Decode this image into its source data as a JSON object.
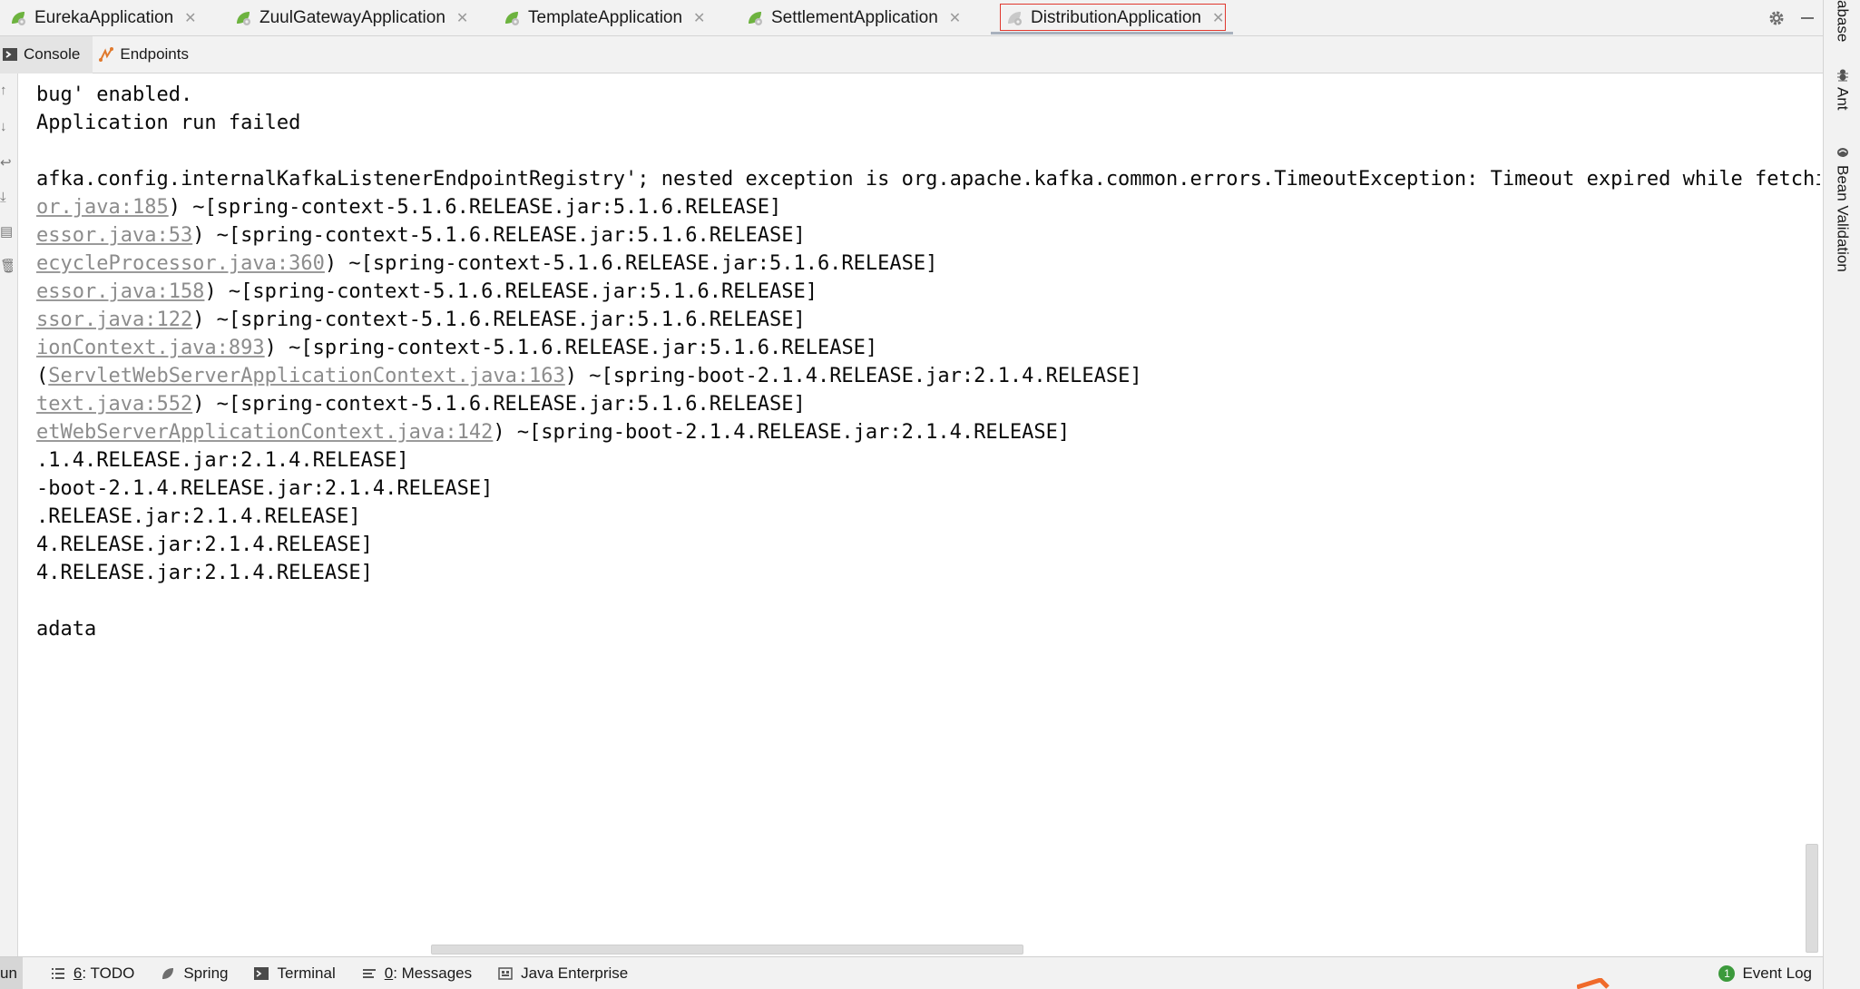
{
  "run_tabs": [
    {
      "label": "EurekaApplication",
      "active": false
    },
    {
      "label": "ZuulGatewayApplication",
      "active": false
    },
    {
      "label": "TemplateApplication",
      "active": false
    },
    {
      "label": "SettlementApplication",
      "active": false
    },
    {
      "label": "DistributionApplication",
      "active": true
    }
  ],
  "sub_tabs": {
    "console": "Console",
    "endpoints": "Endpoints"
  },
  "console_lines": [
    {
      "link": "",
      "text": "bug' enabled."
    },
    {
      "link": "",
      "text": "Application run failed"
    },
    {
      "link": "",
      "text": ""
    },
    {
      "link": "",
      "text": "afka.config.internalKafkaListenerEndpointRegistry'; nested exception is org.apache.kafka.common.errors.TimeoutException: Timeout expired while fetching"
    },
    {
      "prefix": "",
      "link": "or.java:185",
      "text": ") ~[spring-context-5.1.6.RELEASE.jar:5.1.6.RELEASE]"
    },
    {
      "prefix": "",
      "link": "essor.java:53",
      "text": ") ~[spring-context-5.1.6.RELEASE.jar:5.1.6.RELEASE]"
    },
    {
      "prefix": "",
      "link": "ecycleProcessor.java:360",
      "text": ") ~[spring-context-5.1.6.RELEASE.jar:5.1.6.RELEASE]"
    },
    {
      "prefix": "",
      "link": "essor.java:158",
      "text": ") ~[spring-context-5.1.6.RELEASE.jar:5.1.6.RELEASE]"
    },
    {
      "prefix": "",
      "link": "ssor.java:122",
      "text": ") ~[spring-context-5.1.6.RELEASE.jar:5.1.6.RELEASE]"
    },
    {
      "prefix": "",
      "link": "ionContext.java:893",
      "text": ") ~[spring-context-5.1.6.RELEASE.jar:5.1.6.RELEASE]"
    },
    {
      "prefix": "(",
      "link": "ServletWebServerApplicationContext.java:163",
      "text": ") ~[spring-boot-2.1.4.RELEASE.jar:2.1.4.RELEASE]"
    },
    {
      "prefix": "",
      "link": "text.java:552",
      "text": ") ~[spring-context-5.1.6.RELEASE.jar:5.1.6.RELEASE]"
    },
    {
      "prefix": "",
      "link": "etWebServerApplicationContext.java:142",
      "text": ") ~[spring-boot-2.1.4.RELEASE.jar:2.1.4.RELEASE]"
    },
    {
      "prefix": "",
      "link": "",
      "text": ".1.4.RELEASE.jar:2.1.4.RELEASE]"
    },
    {
      "prefix": "",
      "link": "",
      "text": "-boot-2.1.4.RELEASE.jar:2.1.4.RELEASE]"
    },
    {
      "prefix": "",
      "link": "",
      "text": ".RELEASE.jar:2.1.4.RELEASE]"
    },
    {
      "prefix": "",
      "link": "",
      "text": "4.RELEASE.jar:2.1.4.RELEASE]"
    },
    {
      "prefix": "",
      "link": "",
      "text": "4.RELEASE.jar:2.1.4.RELEASE]"
    },
    {
      "prefix": "",
      "link": "",
      "text": ""
    },
    {
      "prefix": "",
      "link": "",
      "text": "adata"
    }
  ],
  "right_strip": {
    "database_label": "abase",
    "ant_label": "Ant",
    "bean_validation_label": "Bean Validation"
  },
  "bottom_bar": {
    "run_label": "un",
    "todo_mnemonic": "6",
    "todo_label": ": TODO",
    "spring_label": "Spring",
    "terminal_label": "Terminal",
    "messages_mnemonic": "0",
    "messages_label": ": Messages",
    "java_enterprise_label": "Java Enterprise",
    "event_log_label": "Event Log",
    "event_log_count": "1"
  },
  "colors": {
    "active_tab_border": "#e0382e",
    "link_gray": "#8c8c8c",
    "spring_green": "#6db33f",
    "event_badge": "#3c9a3c"
  }
}
